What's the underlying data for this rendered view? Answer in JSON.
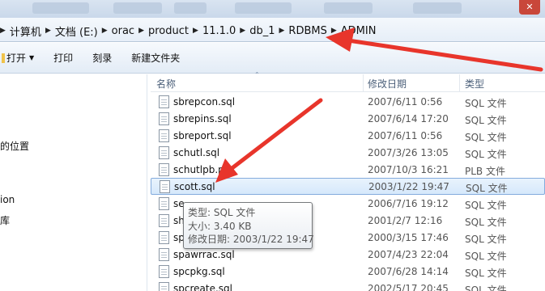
{
  "address_bar": {
    "crumbs": [
      "计算机",
      "文档 (E:)",
      "orac",
      "product",
      "11.1.0",
      "db_1",
      "RDBMS",
      "ADMIN"
    ]
  },
  "toolbar": {
    "open_label": "打开",
    "print_label": "打印",
    "burn_label": "刻录",
    "new_folder_label": "新建文件夹"
  },
  "nav": {
    "items": [
      "的位置",
      "ion",
      "库"
    ]
  },
  "columns": {
    "name": "名称",
    "modified": "修改日期",
    "type": "类型"
  },
  "files": [
    {
      "name": "sbrepcon.sql",
      "modified": "2007/6/11 0:56",
      "type": "SQL 文件"
    },
    {
      "name": "sbrepins.sql",
      "modified": "2007/6/14 17:20",
      "type": "SQL 文件"
    },
    {
      "name": "sbreport.sql",
      "modified": "2007/6/11 0:56",
      "type": "SQL 文件"
    },
    {
      "name": "schutl.sql",
      "modified": "2007/3/26 13:05",
      "type": "SQL 文件"
    },
    {
      "name": "schutlpb.plb",
      "modified": "2007/10/3 16:21",
      "type": "PLB 文件"
    },
    {
      "name": "scott.sql",
      "modified": "2003/1/22 19:47",
      "type": "SQL 文件",
      "selected": true
    },
    {
      "name": "se",
      "modified": "2006/7/16 19:12",
      "type": "SQL 文件"
    },
    {
      "name": "sh",
      "modified": "2001/2/7 12:16",
      "type": "SQL 文件"
    },
    {
      "name": "sp",
      "modified": "2000/3/15 17:46",
      "type": "SQL 文件"
    },
    {
      "name": "spawrrac.sql",
      "modified": "2007/4/23 22:04",
      "type": "SQL 文件"
    },
    {
      "name": "spcpkg.sql",
      "modified": "2007/6/28 14:14",
      "type": "SQL 文件"
    },
    {
      "name": "spcreate.sql",
      "modified": "2002/5/17 20:45",
      "type": "SQL 文件"
    }
  ],
  "tooltip": {
    "type_line": "类型: SQL 文件",
    "size_line": "大小: 3.40 KB",
    "modified_line": "修改日期: 2003/1/22 19:47"
  },
  "colors": {
    "annotation_arrow": "#e8352b",
    "selection_border": "#84acdd"
  }
}
